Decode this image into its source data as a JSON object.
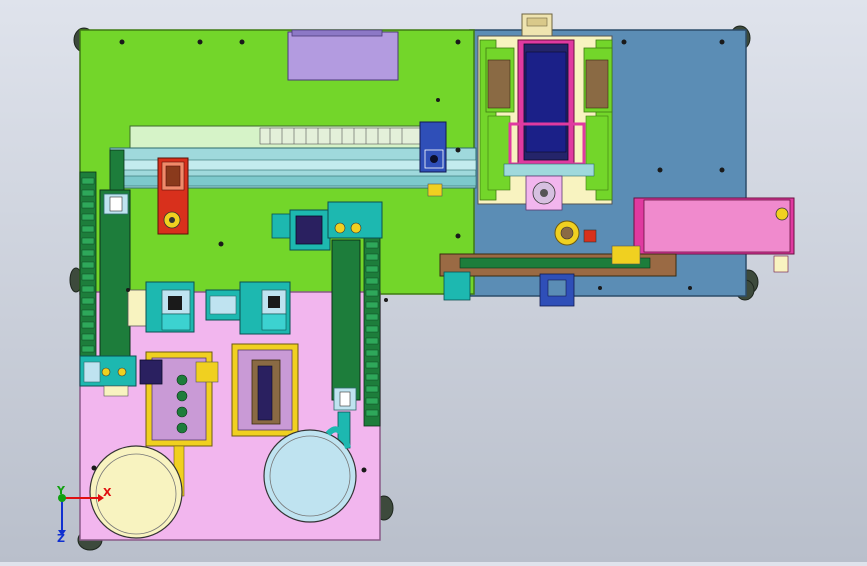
{
  "viewport": {
    "background_top": "#dfe3ec",
    "background_bottom": "#b9bfcb"
  },
  "axes_triad": {
    "x_label": "X",
    "y_label": "Y",
    "z_label": "Z",
    "x_color": "#e01010",
    "y_color": "#10a010",
    "z_color": "#1030d0"
  },
  "colors": {
    "green_plate": "#73d62a",
    "blue_plate": "#5b8db5",
    "pink_plate": "#f2b6ee",
    "teal": "#1db8b0",
    "dark_green": "#1d7d3b",
    "magenta": "#e03aa0",
    "lavender": "#b39be0",
    "yellow": "#f0d020",
    "dark_blue": "#24246a",
    "red_block": "#d8301c",
    "brown_rail": "#9a6a44",
    "light_cyan": "#bfe3f0",
    "cream": "#f8f3c0"
  }
}
